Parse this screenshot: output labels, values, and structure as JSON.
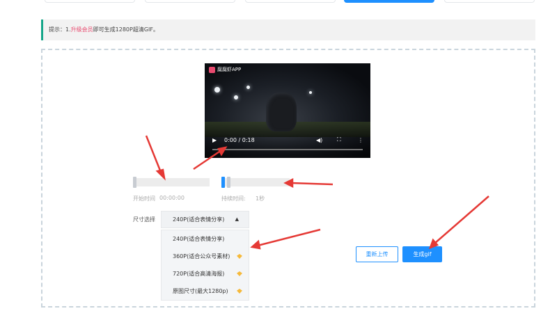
{
  "notice": {
    "prefix": "提示：1.",
    "link": "升级会员",
    "suffix": "即可生成1280P超清GIF。"
  },
  "video": {
    "brand": "腐腐虾APP",
    "time": "0:00 / 0:18",
    "progress_fraction": 0
  },
  "start": {
    "label": "开始时间",
    "value": "00:00:00"
  },
  "duration": {
    "label": "持续时间:",
    "value": "1秒"
  },
  "size": {
    "label": "尺寸选择",
    "selected": "240P(适合表情分享)",
    "options": [
      {
        "label": "240P(适合表情分享)",
        "vip": false
      },
      {
        "label": "360P(适合公众号素材)",
        "vip": true
      },
      {
        "label": "720P(适合高清海报)",
        "vip": true
      },
      {
        "label": "原图尺寸(最大1280p)",
        "vip": true
      }
    ]
  },
  "buttons": {
    "reupload": "重新上传",
    "generate": "生成gif"
  },
  "colors": {
    "accent": "#1e90ff",
    "notice_border": "#15a589",
    "link": "#e84a6f",
    "vip": "#f5b93b",
    "arrow": "#e53935"
  },
  "icons": {
    "play": "play-icon",
    "volume": "volume-icon",
    "fullscreen": "fullscreen-icon",
    "more": "more-icon",
    "caret": "caret-up-icon",
    "vip": "vip-diamond-icon"
  }
}
